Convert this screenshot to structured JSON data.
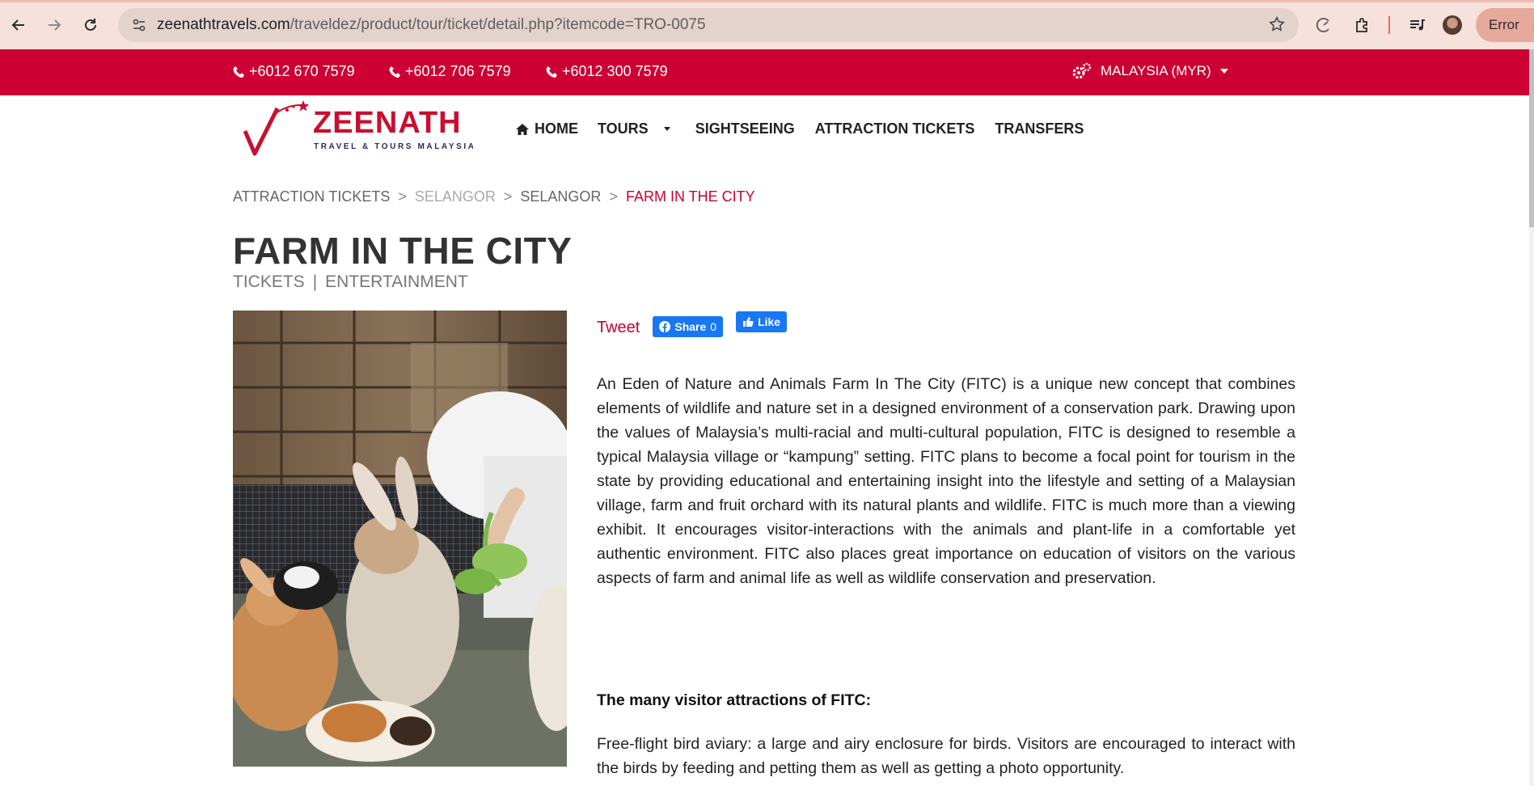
{
  "browser": {
    "url_domain": "zeenathtravels.com",
    "url_path": "/traveldez/product/tour/ticket/detail.php?itemcode=TRO-0075",
    "error_label": "Error"
  },
  "topbar": {
    "phones": [
      "+6012 670 7579",
      "+6012 706 7579",
      "+6012 300 7579"
    ],
    "currency": "MALAYSIA (MYR)"
  },
  "logo": {
    "name": "ZEENATH",
    "tagline": "TRAVEL & TOURS MALAYSIA"
  },
  "nav": {
    "home": "HOME",
    "tours": "TOURS",
    "sightseeing": "SIGHTSEEING",
    "attraction_tickets": "ATTRACTION TICKETS",
    "transfers": "TRANSFERS"
  },
  "breadcrumb": {
    "items": [
      "ATTRACTION TICKETS",
      "SELANGOR",
      "SELANGOR"
    ],
    "separator": ">",
    "current": "FARM IN THE CITY"
  },
  "page": {
    "title": "FARM IN THE CITY",
    "category_1": "TICKETS",
    "category_divider": "|",
    "category_2": "ENTERTAINMENT"
  },
  "social": {
    "tweet": "Tweet",
    "share": "Share",
    "share_count": "0",
    "like": "Like"
  },
  "content": {
    "description": "An Eden of Nature and Animals Farm In The City (FITC) is a unique new concept that combines elements of wildlife and nature set in a designed environment of a conservation park. Drawing upon the values of Malaysia’s multi-racial and multi-cultural population, FITC is designed to resemble a typical Malaysia village or “kampung” setting. FITC plans to become a focal point for tourism in the state by providing educational and entertaining insight into the lifestyle and setting of a Malaysian village, farm and fruit orchard with its natural plants and wildlife. FITC is much more than a viewing exhibit. It encourages visitor-interactions with the animals and plant-life in a comfortable yet authentic environment. FITC also places great importance on education of visitors on the various aspects of farm and animal life as well as wildlife conservation and preservation.",
    "attractions_heading": "The many visitor attractions of FITC:",
    "attraction_1": "Free-flight bird aviary: a large and airy enclosure for birds. Visitors are encouraged to interact with the birds by feeding and petting them as well as getting a photo opportunity."
  },
  "colors": {
    "brand_red": "#cc0033",
    "facebook_blue": "#1877f2"
  }
}
